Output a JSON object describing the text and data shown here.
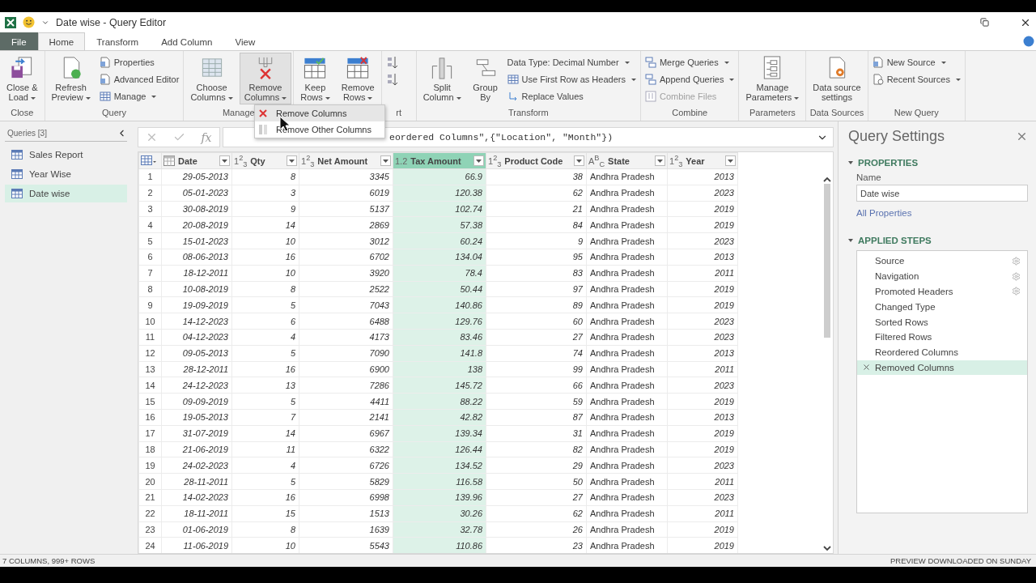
{
  "title_bar": {
    "title": "Date wise - Query Editor"
  },
  "tabs": [
    {
      "label": "File",
      "kind": "file",
      "selected": false
    },
    {
      "label": "Home",
      "kind": "tab",
      "selected": true
    },
    {
      "label": "Transform",
      "kind": "tab",
      "selected": false
    },
    {
      "label": "Add Column",
      "kind": "tab",
      "selected": false
    },
    {
      "label": "View",
      "kind": "tab",
      "selected": false
    }
  ],
  "ribbon": [
    {
      "label": "Close",
      "items": [
        {
          "kind": "large",
          "lines": [
            "Close &",
            "Load"
          ],
          "dropdown": true,
          "pressed": false
        }
      ]
    },
    {
      "label": "Query",
      "items": [
        {
          "kind": "large",
          "lines": [
            "Refresh",
            "Preview"
          ],
          "dropdown": true,
          "pressed": false
        },
        {
          "kind": "stack",
          "entries": [
            {
              "label": "Properties",
              "dropdown": false,
              "disabled": false
            },
            {
              "label": "Advanced Editor",
              "dropdown": false,
              "disabled": false
            },
            {
              "label": "Manage",
              "dropdown": true,
              "disabled": false
            }
          ]
        }
      ]
    },
    {
      "label": "Manage",
      "items": [
        {
          "kind": "large",
          "lines": [
            "Choose",
            "Columns"
          ],
          "dropdown": true,
          "pressed": false
        },
        {
          "kind": "large",
          "lines": [
            "Remove",
            "Columns"
          ],
          "dropdown": true,
          "pressed": true
        }
      ]
    },
    {
      "items": [
        {
          "kind": "large",
          "lines": [
            "Keep",
            "Rows"
          ],
          "dropdown": true,
          "pressed": false
        },
        {
          "kind": "large",
          "lines": [
            "Remove",
            "Rows"
          ],
          "dropdown": true,
          "pressed": false
        }
      ]
    },
    {
      "label": "rt",
      "items": [
        {
          "kind": "sort"
        }
      ]
    },
    {
      "label": "Transform",
      "items": [
        {
          "kind": "large",
          "lines": [
            "Split",
            "Column"
          ],
          "dropdown": true,
          "pressed": false
        },
        {
          "kind": "large",
          "lines": [
            "Group",
            "By"
          ],
          "dropdown": false,
          "pressed": false
        },
        {
          "kind": "stack",
          "entries": [
            {
              "label": "Data Type: Decimal Number",
              "dropdown": true,
              "disabled": false
            },
            {
              "label": "Use First Row as Headers",
              "dropdown": true,
              "disabled": false
            },
            {
              "label": "Replace Values",
              "dropdown": false,
              "disabled": false
            }
          ]
        }
      ]
    },
    {
      "label": "Combine",
      "items": [
        {
          "kind": "stack",
          "entries": [
            {
              "label": "Merge Queries",
              "dropdown": true,
              "disabled": false
            },
            {
              "label": "Append Queries",
              "dropdown": true,
              "disabled": false
            },
            {
              "label": "Combine Files",
              "dropdown": false,
              "disabled": true
            }
          ]
        }
      ]
    },
    {
      "label": "Parameters",
      "items": [
        {
          "kind": "large",
          "lines": [
            "Manage",
            "Parameters"
          ],
          "dropdown": true,
          "pressed": false
        }
      ]
    },
    {
      "label": "Data Sources",
      "items": [
        {
          "kind": "large",
          "lines": [
            "Data source",
            "settings"
          ],
          "dropdown": false,
          "pressed": false
        }
      ]
    },
    {
      "label": "New Query",
      "items": [
        {
          "kind": "stack",
          "entries": [
            {
              "label": "New Source",
              "dropdown": true,
              "disabled": false
            },
            {
              "label": "Recent Sources",
              "dropdown": true,
              "disabled": false
            }
          ]
        }
      ]
    }
  ],
  "dropdown_menu": [
    {
      "label": "Remove Columns",
      "selected": true
    },
    {
      "label": "Remove Other Columns",
      "selected": false
    }
  ],
  "queries_pane": {
    "title": "Queries [3]",
    "items": [
      {
        "label": "Sales Report",
        "selected": false
      },
      {
        "label": "Year Wise",
        "selected": false
      },
      {
        "label": "Date wise",
        "selected": true
      }
    ]
  },
  "formula_bar": {
    "fx": "fx",
    "formula": "eordered Columns\",{\"Location\", \"Month\"})"
  },
  "table": {
    "columns": [
      {
        "name": "Date",
        "kind": "date",
        "selected": false
      },
      {
        "name": "Qty",
        "kind": "number",
        "type_label": "1$^{2}$$_{3}$",
        "selected": false
      },
      {
        "name": "Net Amount",
        "kind": "number",
        "type_label": "1$^{2}$$_{3}$",
        "selected": false
      },
      {
        "name": "Tax Amount",
        "kind": "number",
        "type_label": "1.2",
        "selected": true
      },
      {
        "name": "Product Code",
        "kind": "number",
        "type_label": "1$^{2}$$_{3}$",
        "selected": false
      },
      {
        "name": "State",
        "kind": "text",
        "type_label": "A$^{B}$$_{C}$",
        "selected": false
      },
      {
        "name": "Year",
        "kind": "number",
        "type_label": "1$^{2}$$_{3}$",
        "selected": false
      }
    ],
    "rows": [
      {
        "n": "1",
        "cells": [
          "29-05-2013",
          "8",
          "3345",
          "66.9",
          "38",
          "Andhra Pradesh",
          "2013"
        ]
      },
      {
        "n": "2",
        "cells": [
          "05-01-2023",
          "3",
          "6019",
          "120.38",
          "62",
          "Andhra Pradesh",
          "2023"
        ]
      },
      {
        "n": "3",
        "cells": [
          "30-08-2019",
          "9",
          "5137",
          "102.74",
          "21",
          "Andhra Pradesh",
          "2019"
        ]
      },
      {
        "n": "4",
        "cells": [
          "20-08-2019",
          "14",
          "2869",
          "57.38",
          "84",
          "Andhra Pradesh",
          "2019"
        ]
      },
      {
        "n": "5",
        "cells": [
          "15-01-2023",
          "10",
          "3012",
          "60.24",
          "9",
          "Andhra Pradesh",
          "2023"
        ]
      },
      {
        "n": "6",
        "cells": [
          "08-06-2013",
          "16",
          "6702",
          "134.04",
          "95",
          "Andhra Pradesh",
          "2013"
        ]
      },
      {
        "n": "7",
        "cells": [
          "18-12-2011",
          "10",
          "3920",
          "78.4",
          "83",
          "Andhra Pradesh",
          "2011"
        ]
      },
      {
        "n": "8",
        "cells": [
          "10-08-2019",
          "8",
          "2522",
          "50.44",
          "97",
          "Andhra Pradesh",
          "2019"
        ]
      },
      {
        "n": "9",
        "cells": [
          "19-09-2019",
          "5",
          "7043",
          "140.86",
          "89",
          "Andhra Pradesh",
          "2019"
        ]
      },
      {
        "n": "10",
        "cells": [
          "14-12-2023",
          "6",
          "6488",
          "129.76",
          "60",
          "Andhra Pradesh",
          "2023"
        ]
      },
      {
        "n": "11",
        "cells": [
          "04-12-2023",
          "4",
          "4173",
          "83.46",
          "27",
          "Andhra Pradesh",
          "2023"
        ]
      },
      {
        "n": "12",
        "cells": [
          "09-05-2013",
          "5",
          "7090",
          "141.8",
          "74",
          "Andhra Pradesh",
          "2013"
        ]
      },
      {
        "n": "13",
        "cells": [
          "28-12-2011",
          "16",
          "6900",
          "138",
          "99",
          "Andhra Pradesh",
          "2011"
        ]
      },
      {
        "n": "14",
        "cells": [
          "24-12-2023",
          "13",
          "7286",
          "145.72",
          "66",
          "Andhra Pradesh",
          "2023"
        ]
      },
      {
        "n": "15",
        "cells": [
          "09-09-2019",
          "5",
          "4411",
          "88.22",
          "59",
          "Andhra Pradesh",
          "2019"
        ]
      },
      {
        "n": "16",
        "cells": [
          "19-05-2013",
          "7",
          "2141",
          "42.82",
          "87",
          "Andhra Pradesh",
          "2013"
        ]
      },
      {
        "n": "17",
        "cells": [
          "31-07-2019",
          "14",
          "6967",
          "139.34",
          "31",
          "Andhra Pradesh",
          "2019"
        ]
      },
      {
        "n": "18",
        "cells": [
          "21-06-2019",
          "11",
          "6322",
          "126.44",
          "82",
          "Andhra Pradesh",
          "2019"
        ]
      },
      {
        "n": "19",
        "cells": [
          "24-02-2023",
          "4",
          "6726",
          "134.52",
          "29",
          "Andhra Pradesh",
          "2023"
        ]
      },
      {
        "n": "20",
        "cells": [
          "28-11-2011",
          "5",
          "5829",
          "116.58",
          "50",
          "Andhra Pradesh",
          "2011"
        ]
      },
      {
        "n": "21",
        "cells": [
          "14-02-2023",
          "16",
          "6998",
          "139.96",
          "27",
          "Andhra Pradesh",
          "2023"
        ]
      },
      {
        "n": "22",
        "cells": [
          "18-11-2011",
          "15",
          "1513",
          "30.26",
          "62",
          "Andhra Pradesh",
          "2011"
        ]
      },
      {
        "n": "23",
        "cells": [
          "01-06-2019",
          "8",
          "1639",
          "32.78",
          "26",
          "Andhra Pradesh",
          "2019"
        ]
      },
      {
        "n": "24",
        "cells": [
          "11-06-2019",
          "10",
          "5543",
          "110.86",
          "23",
          "Andhra Pradesh",
          "2019"
        ]
      }
    ]
  },
  "settings_pane": {
    "title": "Query Settings",
    "properties_header": "PROPERTIES",
    "name_label": "Name",
    "name_value": "Date wise",
    "all_properties": "All Properties",
    "steps_header": "APPLIED STEPS",
    "steps": [
      {
        "label": "Source",
        "has_settings": true,
        "selected": false
      },
      {
        "label": "Navigation",
        "has_settings": true,
        "selected": false
      },
      {
        "label": "Promoted Headers",
        "has_settings": true,
        "selected": false
      },
      {
        "label": "Changed Type",
        "has_settings": false,
        "selected": false
      },
      {
        "label": "Sorted Rows",
        "has_settings": false,
        "selected": false
      },
      {
        "label": "Filtered Rows",
        "has_settings": false,
        "selected": false
      },
      {
        "label": "Reordered Columns",
        "has_settings": false,
        "selected": false
      },
      {
        "label": "Removed Columns",
        "has_settings": false,
        "selected": true
      }
    ]
  },
  "status_bar": {
    "left": "7 COLUMNS, 999+ ROWS",
    "right": "PREVIEW DOWNLOADED ON SUNDAY"
  }
}
